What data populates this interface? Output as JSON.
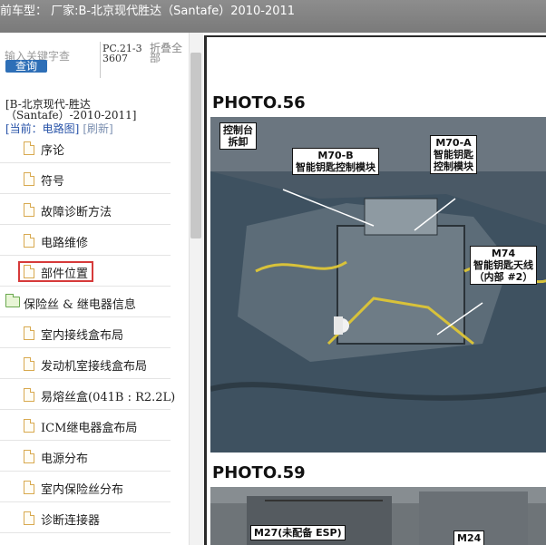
{
  "header": {
    "title": "前车型：  厂家:B-北京现代胜达（Santafe）2010-2011"
  },
  "sidebar": {
    "search_placeholder": "输入关键字查",
    "search_button": "查询",
    "code": "PC.21-33607",
    "collapse_all": "折叠全部",
    "vehicle": "[B-北京现代-胜达（Santafe）-2010-2011]",
    "current_label": "[当前：电路图]",
    "refresh_label": "[刷新]",
    "items": [
      {
        "label": "序论",
        "type": "doc"
      },
      {
        "label": "符号",
        "type": "doc"
      },
      {
        "label": "故障诊断方法",
        "type": "doc"
      },
      {
        "label": "电路维修",
        "type": "doc"
      },
      {
        "label": "部件位置",
        "type": "doc"
      },
      {
        "label": "保险丝 & 继电器信息",
        "type": "folder"
      },
      {
        "label": "室内接线盒布局",
        "type": "doc"
      },
      {
        "label": "发动机室接线盒布局",
        "type": "doc"
      },
      {
        "label": "易熔丝盒(041B : R2.2L)",
        "type": "doc"
      },
      {
        "label": "ICM继电器盒布局",
        "type": "doc"
      },
      {
        "label": "电源分布",
        "type": "doc"
      },
      {
        "label": "室内保险丝分布",
        "type": "doc"
      },
      {
        "label": "诊断连接器",
        "type": "doc"
      }
    ]
  },
  "document": {
    "photo1": {
      "heading": "PHOTO.56",
      "callouts": {
        "console_removed": "控制台\n拆卸",
        "m70b": "M70-B\n智能钥匙控制模块",
        "m70a": "M70-A\n智能钥匙\n控制模块",
        "m74": "M74\n智能钥匙天线\n（内部 #2）"
      }
    },
    "photo2": {
      "heading": "PHOTO.59",
      "callouts": {
        "m27": "M27(未配备 ESP)",
        "m24": "M24"
      }
    }
  }
}
